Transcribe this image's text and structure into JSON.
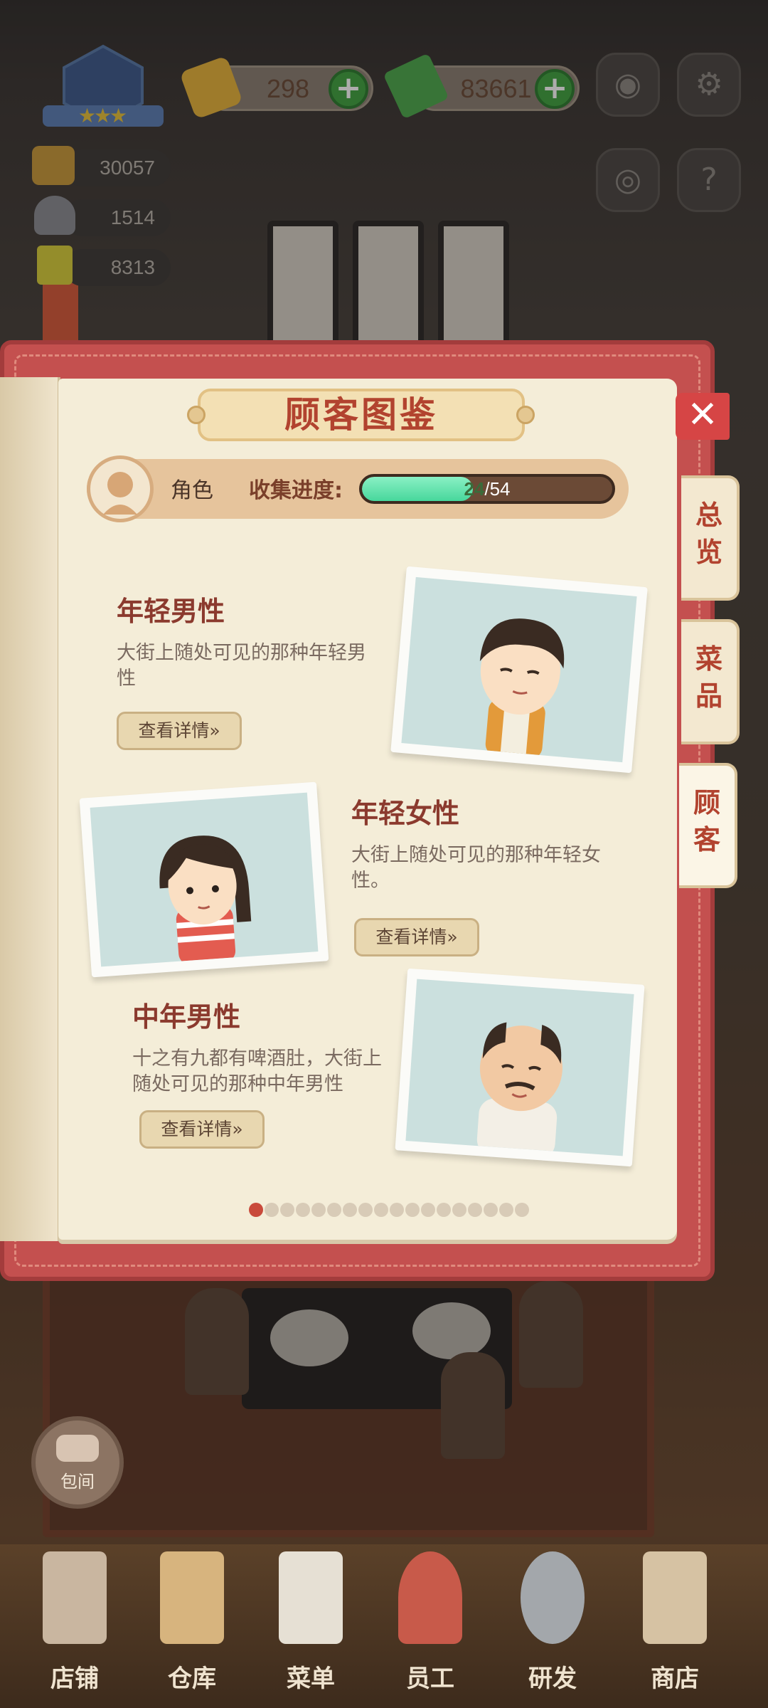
{
  "hud": {
    "gems": "298",
    "cash": "83661",
    "stat1": "30057",
    "stat2": "1514",
    "stat3": "8313"
  },
  "book": {
    "title": "顾客图鉴",
    "role_label": "角色",
    "progress_label": "收集进度:",
    "progress_current": "24",
    "progress_total": "/54",
    "progress_fraction": 0.444,
    "close_label": "✕"
  },
  "tabs": [
    {
      "label": "总览",
      "active": false
    },
    {
      "label": "菜品",
      "active": false
    },
    {
      "label": "顾客",
      "active": true
    }
  ],
  "entries": [
    {
      "title": "年轻男性",
      "desc": "大街上随处可见的那种年轻男性",
      "button": "查看详情»"
    },
    {
      "title": "年轻女性",
      "desc": "大街上随处可见的那种年轻女性。",
      "button": "查看详情»"
    },
    {
      "title": "中年男性",
      "desc": "十之有九都有啤酒肚，大街上随处可见的那种中年男性",
      "button": "查看详情»"
    }
  ],
  "pagination": {
    "total": 18,
    "current": 1
  },
  "room_button": "包间",
  "bottom_nav": [
    "店铺",
    "仓库",
    "菜单",
    "员工",
    "研发",
    "商店"
  ],
  "colors": {
    "accent": "#c4504f",
    "title": "#b2432f",
    "progress": "#47d79c"
  }
}
